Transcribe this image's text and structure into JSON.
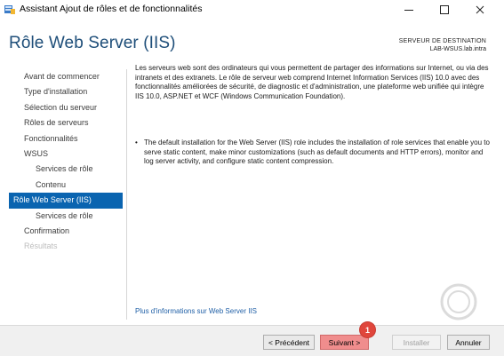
{
  "window": {
    "title": "Assistant Ajout de rôles et de fonctionnalités",
    "app_icon": "server-manager-icon"
  },
  "header": {
    "page_title": "Rôle Web Server (IIS)",
    "destination_label": "SERVEUR DE DESTINATION",
    "destination_server": "LAB-WSUS.lab.intra"
  },
  "sidebar": {
    "items": [
      {
        "label": "Avant de commencer",
        "level": 0,
        "state": "normal"
      },
      {
        "label": "Type d'installation",
        "level": 0,
        "state": "normal"
      },
      {
        "label": "Sélection du serveur",
        "level": 0,
        "state": "normal"
      },
      {
        "label": "Rôles de serveurs",
        "level": 0,
        "state": "normal"
      },
      {
        "label": "Fonctionnalités",
        "level": 0,
        "state": "normal"
      },
      {
        "label": "WSUS",
        "level": 0,
        "state": "normal"
      },
      {
        "label": "Services de rôle",
        "level": 1,
        "state": "normal"
      },
      {
        "label": "Contenu",
        "level": 1,
        "state": "normal"
      },
      {
        "label": "Rôle Web Server (IIS)",
        "level": 0,
        "state": "active"
      },
      {
        "label": "Services de rôle",
        "level": 1,
        "state": "normal"
      },
      {
        "label": "Confirmation",
        "level": 0,
        "state": "normal"
      },
      {
        "label": "Résultats",
        "level": 0,
        "state": "disabled"
      }
    ]
  },
  "content": {
    "intro": "Les serveurs web sont des ordinateurs qui vous permettent de partager des informations sur Internet, ou via des intranets et des extranets. Le rôle de serveur web comprend Internet Information Services (IIS) 10.0 avec des fonctionnalités améliorées de sécurité, de diagnostic et d'administration, une plateforme web unifiée qui intègre IIS 10.0, ASP.NET et WCF (Windows Communication Foundation).",
    "bullet": "The default installation for the Web Server (IIS) role includes the installation of role services that enable you to serve static content, make minor customizations (such as default documents and HTTP errors), monitor and log server activity, and configure static content compression.",
    "more_link": "Plus d'informations sur Web Server IIS"
  },
  "footer": {
    "prev_label": "< Précédent",
    "next_label": "Suivant >",
    "install_label": "Installer",
    "cancel_label": "Annuler",
    "step_badge": "1"
  },
  "colors": {
    "accent": "#0a64b0",
    "title": "#1e4e79",
    "highlight_next": "#f08d8d",
    "badge": "#e0463c"
  }
}
